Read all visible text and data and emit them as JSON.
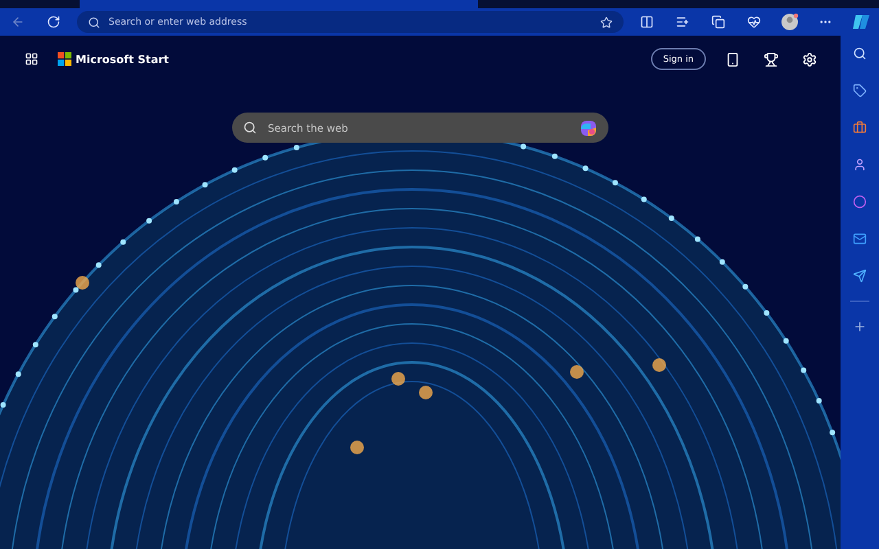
{
  "address_bar": {
    "placeholder": "Search or enter web address"
  },
  "page": {
    "brand": "Microsoft Start",
    "sign_in": "Sign in",
    "search": {
      "placeholder": "Search the web"
    }
  }
}
